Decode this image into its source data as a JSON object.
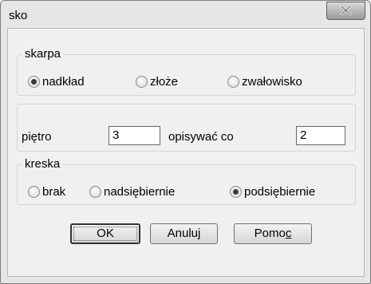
{
  "window": {
    "title": "sko"
  },
  "skarpa": {
    "legend": "skarpa",
    "options": [
      {
        "label": "nadkład",
        "checked": true
      },
      {
        "label": "złoże",
        "checked": false
      },
      {
        "label": "zwałowisko",
        "checked": false
      }
    ]
  },
  "numbering": {
    "pietro_label": "piętro",
    "pietro_value": "3",
    "opisywac_label": "opisywać co",
    "opisywac_value": "2"
  },
  "kreska": {
    "legend": "kreska",
    "options": [
      {
        "label": "brak",
        "checked": false
      },
      {
        "label": "nadsiębiernie",
        "checked": false
      },
      {
        "label": "podsiębiernie",
        "checked": true
      }
    ]
  },
  "buttons": {
    "ok": "OK",
    "cancel": "Anuluj",
    "help_prefix": "Pomo",
    "help_mnemonic": "c"
  }
}
